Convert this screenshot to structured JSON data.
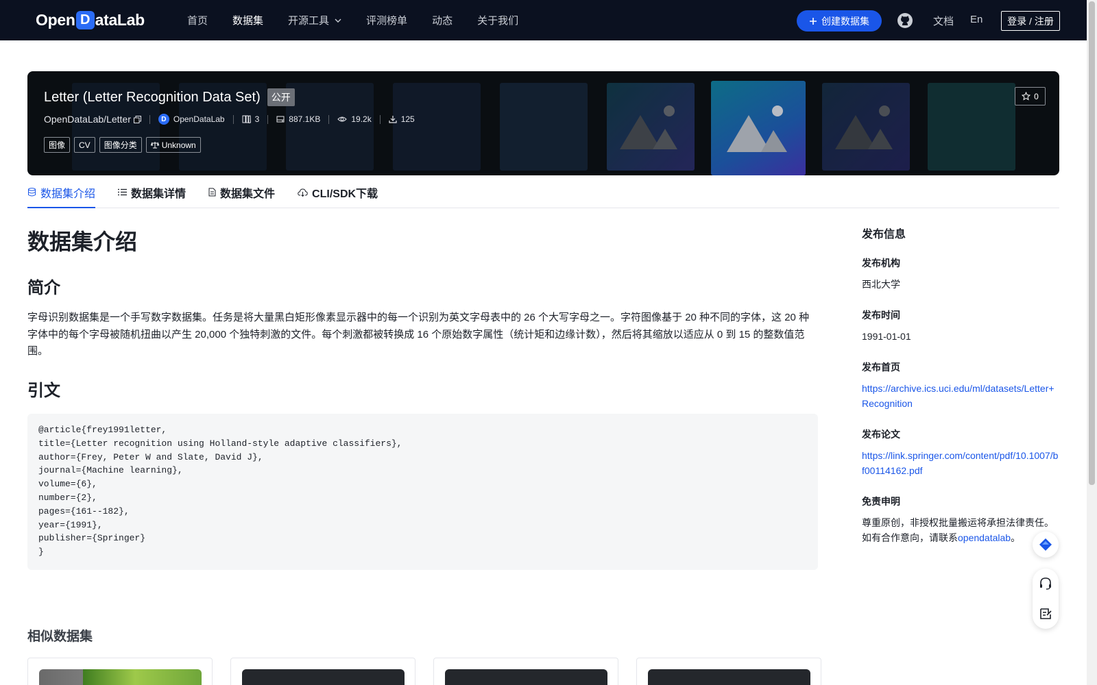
{
  "nav": {
    "logo_left": "Open",
    "logo_mark": "D",
    "logo_right": "ataLab",
    "links": [
      "首页",
      "数据集",
      "开源工具",
      "评测榜单",
      "动态",
      "关于我们"
    ],
    "create_button": "创建数据集",
    "docs": "文档",
    "lang": "En",
    "login": "登录 / 注册"
  },
  "dataset": {
    "title": "Letter (Letter Recognition Data Set)",
    "visibility": "公开",
    "repo": "OpenDataLab/Letter",
    "org": "OpenDataLab",
    "stars_count": "3",
    "size": "887.1KB",
    "views": "19.2k",
    "downloads": "125",
    "tags": [
      "图像",
      "CV",
      "图像分类",
      "Unknown"
    ],
    "favorite_count": "0"
  },
  "tabs": [
    "数据集介绍",
    "数据集详情",
    "数据集文件",
    "CLI/SDK下载"
  ],
  "content": {
    "heading": "数据集介绍",
    "brief_heading": "简介",
    "brief_text": "字母识别数据集是一个手写数字数据集。任务是将大量黑白矩形像素显示器中的每一个识别为英文字母表中的 26 个大写字母之一。字符图像基于 20 种不同的字体，这 20 种字体中的每个字母被随机扭曲以产生 20,000 个独特刺激的文件。每个刺激都被转换成 16 个原始数字属性（统计矩和边缘计数），然后将其缩放以适应从 0 到 15 的整数值范围。",
    "citation_heading": "引文",
    "citation": "@article{frey1991letter,\ntitle={Letter recognition using Holland-style adaptive classifiers},\nauthor={Frey, Peter W and Slate, David J},\njournal={Machine learning},\nvolume={6},\nnumber={2},\npages={161--182},\nyear={1991},\npublisher={Springer}\n}",
    "similar_heading": "相似数据集"
  },
  "sidebar": {
    "title": "发布信息",
    "org_label": "发布机构",
    "org_value": "西北大学",
    "date_label": "发布时间",
    "date_value": "1991-01-01",
    "homepage_label": "发布首页",
    "homepage_value": "https://archive.ics.uci.edu/ml/datasets/Letter+Recognition",
    "paper_label": "发布论文",
    "paper_value": "https://link.springer.com/content/pdf/10.1007/bf00114162.pdf",
    "disclaimer_label": "免责申明",
    "disclaimer_text": "尊重原创，非授权批量搬运将承担法律责任。如有合作意向，请联系",
    "disclaimer_link": "opendatalab",
    "disclaimer_end": "。"
  },
  "colors": {
    "nav_bg": "#0b1120",
    "accent": "#1a56e8",
    "banner_bg": "#0a0e12"
  }
}
